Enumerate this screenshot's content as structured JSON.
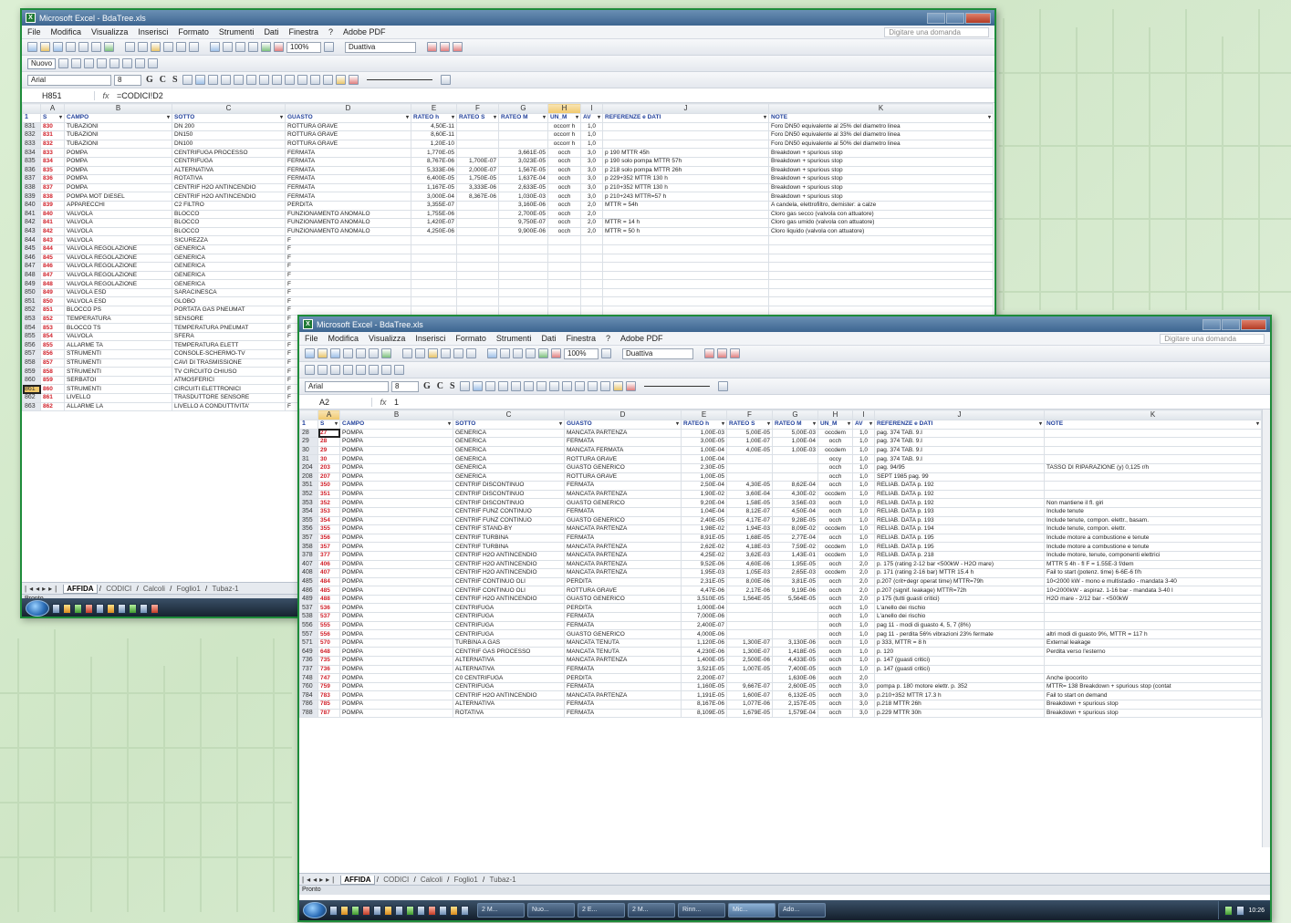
{
  "app_title": "Microsoft Excel - BdaTree.xls",
  "menu": [
    "File",
    "Modifica",
    "Visualizza",
    "Inserisci",
    "Formato",
    "Strumenti",
    "Dati",
    "Finestra",
    "?",
    "Adobe PDF"
  ],
  "help_placeholder": "Digitare una domanda",
  "toolbar": {
    "zoom": "100%",
    "style": "Duattiva",
    "font_name": "Arial",
    "font_size": "8",
    "nuovo": "Nuovo"
  },
  "win1": {
    "name_box": "H851",
    "formula": "=CODICI!D2",
    "columns": [
      "A",
      "B",
      "C",
      "D",
      "E",
      "F",
      "G",
      "H",
      "I",
      "J",
      "K"
    ],
    "selected_column": "H",
    "header": [
      "S",
      "CAMPO",
      "SOTTO",
      "GUASTO",
      "RATEO h",
      "RATEO S",
      "RATEO M",
      "UN_M",
      "AV",
      "REFERENZE e DATI",
      "NOTE"
    ],
    "rows": [
      [
        "831",
        "830",
        "TUBAZIONI",
        "DN 200",
        "ROTTURA GRAVE",
        "4,50E-11",
        "",
        "",
        "occorr h",
        "1,0",
        "",
        "Foro DN50 equivalente al 25% del diametro linea"
      ],
      [
        "832",
        "831",
        "TUBAZIONI",
        "DN150",
        "ROTTURA GRAVE",
        "8,60E-11",
        "",
        "",
        "occorr h",
        "1,0",
        "",
        "Foro DN50 equivalente al 33% del diametro linea"
      ],
      [
        "833",
        "832",
        "TUBAZIONI",
        "DN100",
        "ROTTURA GRAVE",
        "1,20E-10",
        "",
        "",
        "occorr h",
        "1,0",
        "",
        "Foro DN50 equivalente al 50% del diametro linea"
      ],
      [
        "834",
        "833",
        "POMPA",
        "CENTRIFUGA PROCESSO",
        "FERMATA",
        "1,770E-05",
        "",
        "3,661E-05",
        "occh",
        "3,0",
        "p 190 MTTR 45h",
        "Breakdown + spurious stop"
      ],
      [
        "835",
        "834",
        "POMPA",
        "CENTRIFUGA",
        "FERMATA",
        "8,767E-06",
        "1,700E-07",
        "3,023E-05",
        "occh",
        "3,0",
        "p 190 solo pompa MTTR 57h",
        "Breakdown + spurious stop"
      ],
      [
        "836",
        "835",
        "POMPA",
        "ALTERNATIVA",
        "FERMATA",
        "5,333E-06",
        "2,000E-07",
        "1,567E-05",
        "occh",
        "3,0",
        "p 218 solo pompa MTTR 26h",
        "Breakdown + spurious stop"
      ],
      [
        "837",
        "836",
        "POMPA",
        "ROTATIVA",
        "FERMATA",
        "6,400E-05",
        "1,750E-05",
        "1,637E-04",
        "occh",
        "3,0",
        "p 229+352 MTTR 130 h",
        "Breakdown + spurious stop"
      ],
      [
        "838",
        "837",
        "POMPA",
        "CENTRIF H2O ANTINCENDIO",
        "FERMATA",
        "1,167E-05",
        "3,333E-06",
        "2,633E-05",
        "occh",
        "3,0",
        "p 210+352 MTTR 130 h",
        "Breakdown + spurious stop"
      ],
      [
        "839",
        "838",
        "POMPA MOT DIESEL",
        "CENTRIF H2O ANTINCENDIO",
        "FERMATA",
        "3,000E-04",
        "8,367E-06",
        "1,030E-03",
        "occh",
        "3,0",
        "p 210+243 MTTR=57 h",
        "Breakdown + spurious stop"
      ],
      [
        "840",
        "839",
        "APPARECCHI",
        "C2 FILTRO",
        "PERDITA",
        "3,355E-07",
        "",
        "3,160E-06",
        "occh",
        "2,0",
        "MTTR = 54h",
        "A candela, elettrofiltro, demister: a calze"
      ],
      [
        "841",
        "840",
        "VALVOLA",
        "BLOCCO",
        "FUNZIONAMENTO ANOMALO",
        "1,755E-06",
        "",
        "2,700E-05",
        "occh",
        "2,0",
        "",
        "Cloro gas secco (valvola con attuatore)"
      ],
      [
        "842",
        "841",
        "VALVOLA",
        "BLOCCO",
        "FUNZIONAMENTO ANOMALO",
        "1,420E-07",
        "",
        "9,750E-07",
        "occh",
        "2,0",
        "MTTR = 14 h",
        "Cloro gas umido (valvola con attuatore)"
      ],
      [
        "843",
        "842",
        "VALVOLA",
        "BLOCCO",
        "FUNZIONAMENTO ANOMALO",
        "4,250E-06",
        "",
        "9,900E-06",
        "occh",
        "2,0",
        "MTTR = 50 h",
        "Cloro liquido (valvola con attuatore)"
      ],
      [
        "844",
        "843",
        "VALVOLA",
        "SICUREZZA",
        "F",
        "",
        "",
        "",
        "",
        "",
        "",
        ""
      ],
      [
        "845",
        "844",
        "VALVOLA REGOLAZIONE",
        "GENERICA",
        "F",
        "",
        "",
        "",
        "",
        "",
        "",
        ""
      ],
      [
        "846",
        "845",
        "VALVOLA REGOLAZIONE",
        "GENERICA",
        "F",
        "",
        "",
        "",
        "",
        "",
        "",
        ""
      ],
      [
        "847",
        "846",
        "VALVOLA REGOLAZIONE",
        "GENERICA",
        "F",
        "",
        "",
        "",
        "",
        "",
        "",
        ""
      ],
      [
        "848",
        "847",
        "VALVOLA REGOLAZIONE",
        "GENERICA",
        "F",
        "",
        "",
        "",
        "",
        "",
        "",
        ""
      ],
      [
        "849",
        "848",
        "VALVOLA REGOLAZIONE",
        "GENERICA",
        "F",
        "",
        "",
        "",
        "",
        "",
        "",
        ""
      ],
      [
        "850",
        "849",
        "VALVOLA ESD",
        "SARACINESCA",
        "F",
        "",
        "",
        "",
        "",
        "",
        "",
        ""
      ],
      [
        "851",
        "850",
        "VALVOLA ESD",
        "GLOBO",
        "F",
        "",
        "",
        "",
        "",
        "",
        "",
        ""
      ],
      [
        "852",
        "851",
        "BLOCCO PS",
        "PORTATA GAS PNEUMAT",
        "F",
        "",
        "",
        "",
        "",
        "",
        "",
        ""
      ],
      [
        "853",
        "852",
        "TEMPERATURA",
        "SENSORE",
        "F",
        "",
        "",
        "",
        "",
        "",
        "",
        ""
      ],
      [
        "854",
        "853",
        "BLOCCO TS",
        "TEMPERATURA PNEUMAT",
        "F",
        "",
        "",
        "",
        "",
        "",
        "",
        ""
      ],
      [
        "855",
        "854",
        "VALVOLA",
        "SFERA",
        "F",
        "",
        "",
        "",
        "",
        "",
        "",
        ""
      ],
      [
        "856",
        "855",
        "ALLARME TA",
        "TEMPERATURA ELETT",
        "F",
        "",
        "",
        "",
        "",
        "",
        "",
        ""
      ],
      [
        "857",
        "856",
        "STRUMENTI",
        "CONSOLE-SCHERMO-TV",
        "F",
        "",
        "",
        "",
        "",
        "",
        "",
        ""
      ],
      [
        "858",
        "857",
        "STRUMENTI",
        "CAVI DI TRASMISSIONE",
        "F",
        "",
        "",
        "",
        "",
        "",
        "",
        ""
      ],
      [
        "859",
        "858",
        "STRUMENTI",
        "TV CIRCUITO CHIUSO",
        "F",
        "",
        "",
        "",
        "",
        "",
        "",
        ""
      ],
      [
        "860",
        "859",
        "SERBATOI",
        "ATMOSFERICI",
        "F",
        "",
        "",
        "",
        "",
        "",
        "",
        ""
      ],
      [
        "861",
        "860",
        "STRUMENTI",
        "CIRCUITI ELETTRONICI",
        "F",
        "",
        "",
        "",
        "",
        "",
        "",
        ""
      ],
      [
        "862",
        "861",
        "LIVELLO",
        "TRASDUTTORE SENSORE",
        "F",
        "",
        "",
        "",
        "",
        "",
        "",
        ""
      ],
      [
        "863",
        "862",
        "ALLARME LA",
        "LIVELLO A CONDUTTIVITA'",
        "F",
        "",
        "",
        "",
        "",
        "",
        "",
        ""
      ]
    ],
    "selected_row": "861",
    "tabs": [
      "AFFIDA",
      "CODICI",
      "Calcoli",
      "Foglio1",
      "Tubaz-1"
    ],
    "status": "Pronto"
  },
  "win2": {
    "name_box": "A2",
    "formula": "1",
    "columns": [
      "A",
      "B",
      "C",
      "D",
      "E",
      "F",
      "G",
      "H",
      "I",
      "J",
      "K"
    ],
    "selected_column": "A",
    "header": [
      "S",
      "CAMPO",
      "SOTTO",
      "GUASTO",
      "RATEO h",
      "RATEO S",
      "RATEO M",
      "UN_M",
      "AV",
      "REFERENZE e DATI",
      "NOTE"
    ],
    "rows": [
      [
        "28",
        "27",
        "POMPA",
        "GENERICA",
        "MANCATA PARTENZA",
        "1,00E-03",
        "5,00E-05",
        "5,00E-03",
        "occdem",
        "1,0",
        "pag. 374 TAB. 9.I",
        ""
      ],
      [
        "29",
        "28",
        "POMPA",
        "GENERICA",
        "FERMATA",
        "3,00E-05",
        "1,00E-07",
        "1,00E-04",
        "occh",
        "1,0",
        "pag. 374 TAB. 9.I",
        ""
      ],
      [
        "30",
        "29",
        "POMPA",
        "GENERICA",
        "MANCATA FERMATA",
        "1,00E-04",
        "4,00E-05",
        "1,00E-03",
        "occdem",
        "1,0",
        "pag. 374 TAB. 9.I",
        ""
      ],
      [
        "31",
        "30",
        "POMPA",
        "GENERICA",
        "ROTTURA GRAVE",
        "1,00E-04",
        "",
        "",
        "occy",
        "1,0",
        "pag. 374 TAB. 9.I",
        ""
      ],
      [
        "204",
        "203",
        "POMPA",
        "GENERICA",
        "GUASTO GENERICO",
        "2,30E-05",
        "",
        "",
        "occh",
        "1,0",
        "pag. 94/95",
        "TASSO DI RIPARAZIONE (y) 0,125 r/h"
      ],
      [
        "208",
        "207",
        "POMPA",
        "GENERICA",
        "ROTTURA GRAVE",
        "1,00E-05",
        "",
        "",
        "occh",
        "1,0",
        "SEPT 1985 pag. 99",
        ""
      ],
      [
        "351",
        "350",
        "POMPA",
        "CENTRIF DISCONTINUO",
        "FERMATA",
        "2,50E-04",
        "4,30E-05",
        "8,62E-04",
        "occh",
        "1,0",
        "RELIAB. DATA p. 192",
        ""
      ],
      [
        "352",
        "351",
        "POMPA",
        "CENTRIF DISCONTINUO",
        "MANCATA PARTENZA",
        "1,90E-02",
        "3,60E-04",
        "4,30E-02",
        "occdem",
        "1,0",
        "RELIAB. DATA p. 192",
        ""
      ],
      [
        "353",
        "352",
        "POMPA",
        "CENTRIF DISCONTINUO",
        "GUASTO GENERICO",
        "9,20E-04",
        "1,58E-05",
        "3,56E-03",
        "occh",
        "1,0",
        "RELIAB. DATA p. 192",
        "Non mantiene il fl. giri"
      ],
      [
        "354",
        "353",
        "POMPA",
        "CENTRIF FUNZ CONTINUO",
        "FERMATA",
        "1,04E-04",
        "8,12E-07",
        "4,50E-04",
        "occh",
        "1,0",
        "RELIAB. DATA p. 193",
        "Include tenute"
      ],
      [
        "355",
        "354",
        "POMPA",
        "CENTRIF FUNZ CONTINUO",
        "GUASTO GENERICO",
        "2,40E-05",
        "4,17E-07",
        "9,28E-05",
        "occh",
        "1,0",
        "RELIAB. DATA p. 193",
        "Include tenute, compon. elettr., basam."
      ],
      [
        "356",
        "355",
        "POMPA",
        "CENTRIF STAND-BY",
        "MANCATA PARTENZA",
        "1,98E-02",
        "1,94E-03",
        "8,09E-02",
        "occdem",
        "1,0",
        "RELIAB. DATA p. 194",
        "Include tenute, compon. elettr."
      ],
      [
        "357",
        "356",
        "POMPA",
        "CENTRIF TURBINA",
        "FERMATA",
        "8,91E-05",
        "1,68E-05",
        "2,77E-04",
        "occh",
        "1,0",
        "RELIAB. DATA p. 195",
        "Include motore a combustione e tenute"
      ],
      [
        "358",
        "357",
        "POMPA",
        "CENTRIF TURBINA",
        "MANCATA PARTENZA",
        "2,62E-02",
        "4,18E-03",
        "7,59E-02",
        "occdem",
        "1,0",
        "RELIAB. DATA p. 195",
        "Include motore a combustione e tenute"
      ],
      [
        "378",
        "377",
        "POMPA",
        "CENTRIF H2O ANTINCENDIO",
        "MANCATA PARTENZA",
        "4,25E-02",
        "3,62E-03",
        "1,43E-01",
        "occdem",
        "1,0",
        "RELIAB. DATA p. 218",
        "Include motore, tenute, componenti elettrici"
      ],
      [
        "407",
        "406",
        "POMPA",
        "CENTRIF H2O ANTINCENDIO",
        "MANCATA PARTENZA",
        "9,52E-06",
        "4,60E-06",
        "1,95E-05",
        "occh",
        "2,0",
        "p. 175 (rating 2-12 bar <500kW - H2O mare)",
        "MTTR 5 4h - fl F = 1.55E-3 f/dem"
      ],
      [
        "408",
        "407",
        "POMPA",
        "CENTRIF H2O ANTINCENDIO",
        "MANCATA PARTENZA",
        "1,95E-03",
        "1,05E-03",
        "2,65E-03",
        "occdem",
        "2,0",
        "p. 171 (rating 2-16 bar) MTTR 15.4 h",
        "Fail to start (potenz. time) 6-6E-6 f/h"
      ],
      [
        "485",
        "484",
        "POMPA",
        "CENTRIF CONTINUO OLI",
        "PERDITA",
        "2,31E-05",
        "8,00E-06",
        "3,81E-05",
        "occh",
        "2,0",
        "p.207 (crit+degr operat time) MTTR=79h",
        "10<2000 kW - mono e multistadio - mandata 3-40"
      ],
      [
        "486",
        "485",
        "POMPA",
        "CENTRIF CONTINUO OLI",
        "ROTTURA GRAVE",
        "4,47E-06",
        "2,17E-06",
        "9,19E-06",
        "occh",
        "2,0",
        "p.207 (signif. leakage) MTTR=72h",
        "10<2000kW - aspiraz. 1-16 bar - mandata 3-40 l"
      ],
      [
        "489",
        "488",
        "POMPA",
        "CENTRIF H2O ANTINCENDIO",
        "GUASTO GENERICO",
        "3,510E-05",
        "1,564E-05",
        "5,564E-05",
        "occh",
        "2,0",
        "p 175 (tutti guasti critici)",
        "H2O mare - 2/12 bar - <500kW"
      ],
      [
        "537",
        "536",
        "POMPA",
        "CENTRIFUGA",
        "PERDITA",
        "1,000E-04",
        "",
        "",
        "occh",
        "1,0",
        "L'anello dei rischio",
        ""
      ],
      [
        "538",
        "537",
        "POMPA",
        "CENTRIFUGA",
        "FERMATA",
        "7,000E-06",
        "",
        "",
        "occh",
        "1,0",
        "L'anello dei rischio",
        ""
      ],
      [
        "556",
        "555",
        "POMPA",
        "CENTRIFUGA",
        "FERMATA",
        "2,400E-07",
        "",
        "",
        "occh",
        "1,0",
        "pag 11 - modi di guasto 4, 5, 7 (8%)",
        ""
      ],
      [
        "557",
        "556",
        "POMPA",
        "CENTRIFUGA",
        "GUASTO GENERICO",
        "4,000E-06",
        "",
        "",
        "occh",
        "1,0",
        "pag 11 - perdita 56% vibrazioni 23% fermate",
        "altri modi di guasto 9%, MTTR = 117 h"
      ],
      [
        "571",
        "570",
        "POMPA",
        "TURBINA A GAS",
        "MANCATA TENUTA",
        "1,120E-06",
        "1,300E-07",
        "3,130E-06",
        "occh",
        "1,0",
        "p 333, MTTR = 8 h",
        "External leakage"
      ],
      [
        "649",
        "648",
        "POMPA",
        "CENTRIF GAS PROCESSO",
        "MANCATA TENUTA",
        "4,230E-06",
        "1,300E-07",
        "1,418E-05",
        "occh",
        "1,0",
        "p. 120",
        "Perdita verso l'esterno"
      ],
      [
        "736",
        "735",
        "POMPA",
        "ALTERNATIVA",
        "MANCATA PARTENZA",
        "1,400E-05",
        "2,500E-06",
        "4,433E-05",
        "occh",
        "1,0",
        "p. 147 (guasti critici)",
        ""
      ],
      [
        "737",
        "736",
        "POMPA",
        "ALTERNATIVA",
        "FERMATA",
        "3,521E-05",
        "1,007E-05",
        "7,400E-05",
        "occh",
        "1,0",
        "p. 147 (guasti critici)",
        ""
      ],
      [
        "748",
        "747",
        "POMPA",
        "C0 CENTRIFUGA",
        "PERDITA",
        "2,200E-07",
        "",
        "1,630E-06",
        "occh",
        "2,0",
        "",
        "Anche ipocorito"
      ],
      [
        "760",
        "759",
        "POMPA",
        "CENTRIFUGA",
        "FERMATA",
        "1,160E-05",
        "9,667E-07",
        "2,600E-05",
        "occh",
        "3,0",
        "pompa p. 180 motore elettr. p. 352",
        "MTTR= 138 Breakdown + spurious stop (contat"
      ],
      [
        "784",
        "783",
        "POMPA",
        "CENTRIF H2O ANTINCENDIO",
        "MANCATA PARTENZA",
        "1,191E-05",
        "1,600E-07",
        "6,132E-05",
        "occh",
        "3,0",
        "p.210+352 MTTR 17.3 h",
        "Fail to start on demand"
      ],
      [
        "786",
        "785",
        "POMPA",
        "ALTERNATIVA",
        "FERMATA",
        "8,167E-06",
        "1,077E-06",
        "2,157E-05",
        "occh",
        "3,0",
        "p.218 MTTR 26h",
        "Breakdown + spurious stop"
      ],
      [
        "788",
        "787",
        "POMPA",
        "ROTATIVA",
        "FERMATA",
        "8,109E-05",
        "1,679E-05",
        "1,579E-04",
        "occh",
        "3,0",
        "p.229 MTTR 30h",
        "Breakdown + spurious stop"
      ]
    ],
    "tabs": [
      "AFFIDA",
      "CODICI",
      "Calcoli",
      "Foglio1",
      "Tubaz-1"
    ],
    "status": "Pronto",
    "taskbar": [
      "2 M...",
      "Nuo...",
      "2 E...",
      "2 M...",
      "Rinn...",
      "Mic...",
      "Ado..."
    ],
    "clock": "10:26"
  }
}
